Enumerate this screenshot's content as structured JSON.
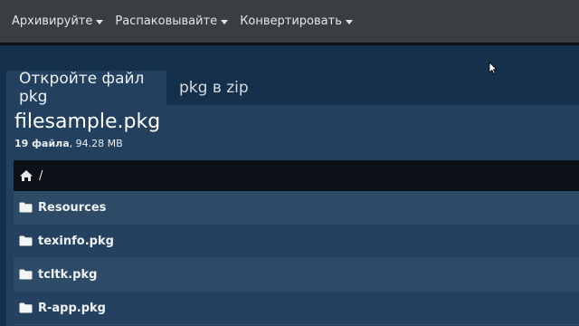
{
  "navbar": {
    "items": [
      {
        "label": "Архивируйте"
      },
      {
        "label": "Распаковывайте"
      },
      {
        "label": "Конвертировать"
      }
    ]
  },
  "tabs": [
    {
      "label": "Откройте файл pkg",
      "active": true
    },
    {
      "label": "pkg в zip",
      "active": false
    }
  ],
  "file": {
    "name": "filesample.pkg",
    "count_label": "19 файла",
    "size": ", 94.28 MB"
  },
  "breadcrumb": {
    "separator": "/"
  },
  "entries": [
    {
      "name": "Resources",
      "icon": "folder-icon"
    },
    {
      "name": "texinfo.pkg",
      "icon": "folder-icon"
    },
    {
      "name": "tcltk.pkg",
      "icon": "folder-icon"
    },
    {
      "name": "R-app.pkg",
      "icon": "folder-icon"
    }
  ],
  "colors": {
    "navbar_bg": "#3a3e43",
    "page_bg": "#14304a",
    "panel_bg": "#23415e",
    "header_row_bg": "#0c1117"
  }
}
